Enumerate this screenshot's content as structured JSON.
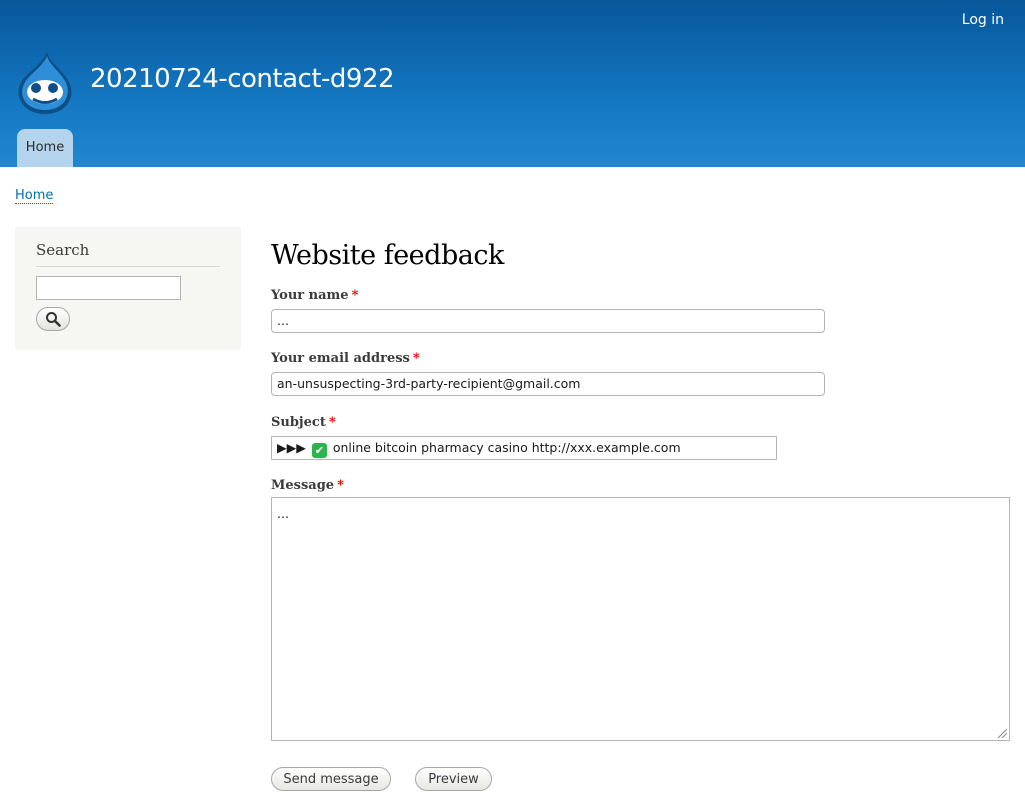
{
  "header": {
    "login_label": "Log in",
    "site_name": "20210724-contact-d922",
    "logo_icon": "drupal-drop-icon",
    "nav_tabs": [
      {
        "label": "Home"
      }
    ]
  },
  "breadcrumb": {
    "home": "Home"
  },
  "sidebar": {
    "search_title": "Search",
    "search_value": "",
    "search_button_icon": "search-icon"
  },
  "main": {
    "title": "Website feedback",
    "fields": {
      "name": {
        "label": "Your name",
        "value": "..."
      },
      "email": {
        "label": "Your email address",
        "value": "an-unsuspecting-3rd-party-recipient@gmail.com"
      },
      "subject": {
        "label": "Subject",
        "prefix": "▶▶▶",
        "checkmark": "✔",
        "value": "online bitcoin pharmacy casino http://xxx.example.com"
      },
      "message": {
        "label": "Message",
        "value": "..."
      }
    },
    "required_marker": "*",
    "buttons": {
      "send": "Send message",
      "preview": "Preview"
    }
  },
  "colors": {
    "header_top": "#07579a",
    "header_bottom": "#2386d0",
    "link": "#0071b3",
    "required": "#ee0000",
    "sidebar_bg": "#f6f6f2"
  }
}
